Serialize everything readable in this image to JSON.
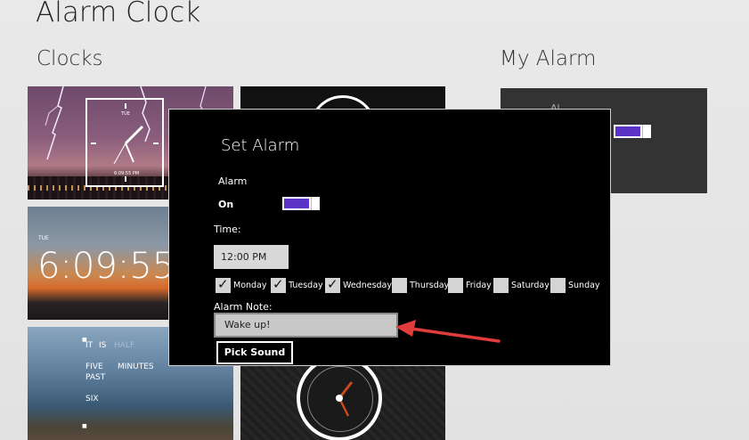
{
  "app": {
    "title": "Alarm Clock"
  },
  "sections": {
    "clocks": "Clocks",
    "my_alarm": "My Alarm"
  },
  "tiles": {
    "lightning": {
      "day": "TUE",
      "digital": "6:09:55 PM"
    },
    "digital": {
      "day": "TUE",
      "time": "6:09:55"
    },
    "word": {
      "words": [
        "IT",
        "IS",
        "HALF",
        "FIVE",
        "MINUTES",
        "PAST",
        "SIX"
      ]
    },
    "my_alarm": {
      "label": "Al"
    }
  },
  "dialog": {
    "title": "Set Alarm",
    "alarm_label": "Alarm",
    "alarm_state": "On",
    "time_label": "Time:",
    "time_value": "12:00 PM",
    "days": [
      {
        "label": "Monday",
        "checked": true
      },
      {
        "label": "Tuesday",
        "checked": true
      },
      {
        "label": "Wednesday",
        "checked": true
      },
      {
        "label": "Thursday",
        "checked": false
      },
      {
        "label": "Friday",
        "checked": false
      },
      {
        "label": "Saturday",
        "checked": false
      },
      {
        "label": "Sunday",
        "checked": false
      }
    ],
    "note_label": "Alarm Note:",
    "note_value": "Wake up!",
    "pick_sound_label": "Pick Sound"
  },
  "colors": {
    "toggle_accent": "#5b34c7",
    "arrow": "#e23b3b",
    "dialog_bg": "#000000"
  }
}
